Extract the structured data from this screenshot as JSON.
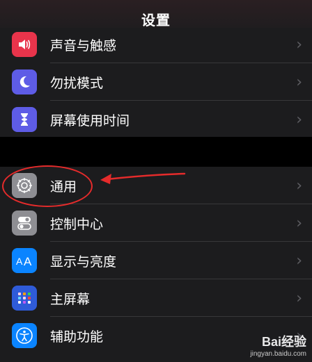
{
  "header": {
    "title": "设置"
  },
  "groups": [
    {
      "items": [
        {
          "label": "声音与触感",
          "icon": "speaker-icon",
          "color": "#e8344b"
        },
        {
          "label": "勿扰模式",
          "icon": "moon-icon",
          "color": "#5e5ce6"
        },
        {
          "label": "屏幕使用时间",
          "icon": "hourglass-icon",
          "color": "#5e5ce6"
        }
      ]
    },
    {
      "items": [
        {
          "label": "通用",
          "icon": "gear-icon",
          "color": "#8e8e93"
        },
        {
          "label": "控制中心",
          "icon": "toggles-icon",
          "color": "#8e8e93"
        },
        {
          "label": "显示与亮度",
          "icon": "text-size-icon",
          "color": "#0a84ff"
        },
        {
          "label": "主屏幕",
          "icon": "home-grid-icon",
          "color": "#2f5bd8"
        },
        {
          "label": "辅助功能",
          "icon": "accessibility-icon",
          "color": "#0a84ff"
        }
      ]
    }
  ],
  "chevron": "›",
  "watermark": {
    "brand": "Bai经验",
    "sub": "jingyan.baidu.com"
  },
  "annotation": {
    "color": "#e52b2b",
    "target": "通用"
  }
}
